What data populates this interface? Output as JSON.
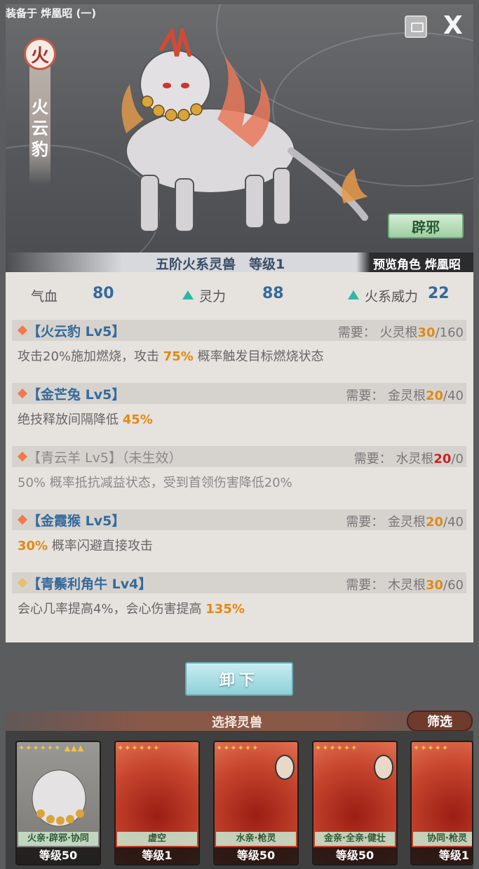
{
  "header": {
    "equip_label": "装备于 烨凰昭 (一)",
    "close_label": "X"
  },
  "beast": {
    "element": "火",
    "name": "火云豹",
    "tag_button": "辟邪",
    "grade": "五阶火系灵兽　等级1",
    "preview": "预览角色 烨凰昭"
  },
  "stats": {
    "hp_label": "气血",
    "hp_value": "80",
    "spirit_label": "灵力",
    "spirit_value": "88",
    "fire_label": "火系威力",
    "fire_value": "22"
  },
  "skills": [
    {
      "name": "【火云豹 Lv5】",
      "req_label": "需要：",
      "req_root": "火灵根",
      "req_have": "30",
      "req_need": "/160",
      "desc_a": "攻击20%施加燃烧，攻击 ",
      "desc_hl": "75%",
      "desc_b": " 概率触发目标燃烧状态"
    },
    {
      "name": "【金芒兔 Lv5】",
      "req_label": "需要：",
      "req_root": "金灵根",
      "req_have": "20",
      "req_need": "/40",
      "desc_a": "绝技释放间隔降低 ",
      "desc_hl": "45%",
      "desc_b": ""
    },
    {
      "name": "【青云羊 Lv5】（未生效）",
      "req_label": "需要：",
      "req_root": "水灵根",
      "req_have": "20",
      "req_need": "/0",
      "desc_a": "50% 概率抵抗减益状态，受到首领伤害降低20%",
      "desc_hl": "",
      "desc_b": ""
    },
    {
      "name": "【金霞猴 Lv5】",
      "req_label": "需要：",
      "req_root": "金灵根",
      "req_have": "20",
      "req_need": "/40",
      "desc_a": "",
      "desc_hl": "30%",
      "desc_b": " 概率闪避直接攻击"
    },
    {
      "name": "【青鬃利角牛 Lv4】",
      "req_label": "需要：",
      "req_root": "木灵根",
      "req_have": "30",
      "req_need": "/60",
      "desc_a": "会心几率提高4%，会心伤害提高 ",
      "desc_hl": "135%",
      "desc_b": ""
    }
  ],
  "unequip_label": "卸下",
  "select_label": "选择灵兽",
  "filter_label": "筛选",
  "cards": [
    {
      "tag": "火亲·辟邪·协同",
      "level": "等级50"
    },
    {
      "tag": "虚空",
      "level": "等级1"
    },
    {
      "tag": "水亲·枪灵",
      "level": "等级50"
    },
    {
      "tag": "金亲·全亲·健壮",
      "level": "等级50"
    },
    {
      "tag": "协同·枪灵",
      "level": "等级1"
    }
  ],
  "colors": {
    "accent_blue": "#356a9a",
    "highlight_orange": "#e08a14",
    "warning_red": "#cc2222",
    "panel_bg": "#e6e2de"
  }
}
